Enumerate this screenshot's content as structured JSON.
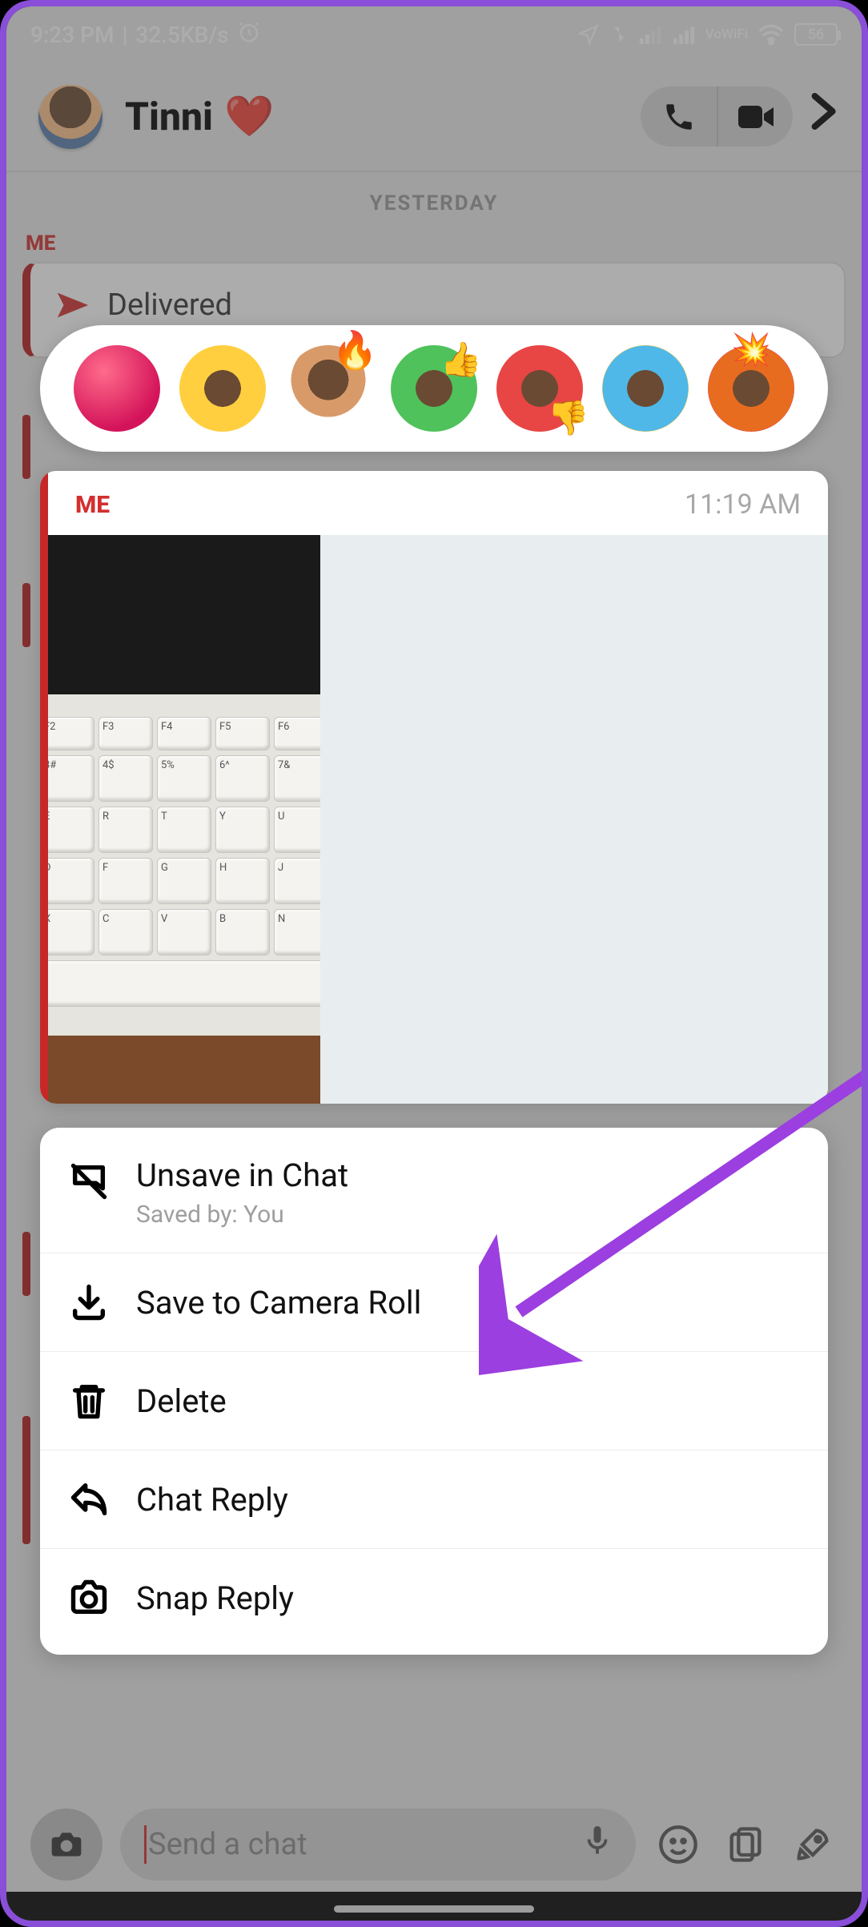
{
  "status": {
    "time": "9:23 PM",
    "speed": "32.5KB/s",
    "vowifi": "VoWiFi",
    "battery": "56"
  },
  "header": {
    "name": "Tinni",
    "emoji": "❤️"
  },
  "day_divider": "YESTERDAY",
  "sender_label": "ME",
  "delivered": "Delivered",
  "msg": {
    "sender": "ME",
    "time": "11:19 AM"
  },
  "menu": {
    "unsave": "Unsave in Chat",
    "saved_by": "Saved by: You",
    "save_roll": "Save to Camera Roll",
    "delete": "Delete",
    "chat_reply": "Chat Reply",
    "snap_reply": "Snap Reply"
  },
  "input": {
    "placeholder": "Send a chat"
  }
}
